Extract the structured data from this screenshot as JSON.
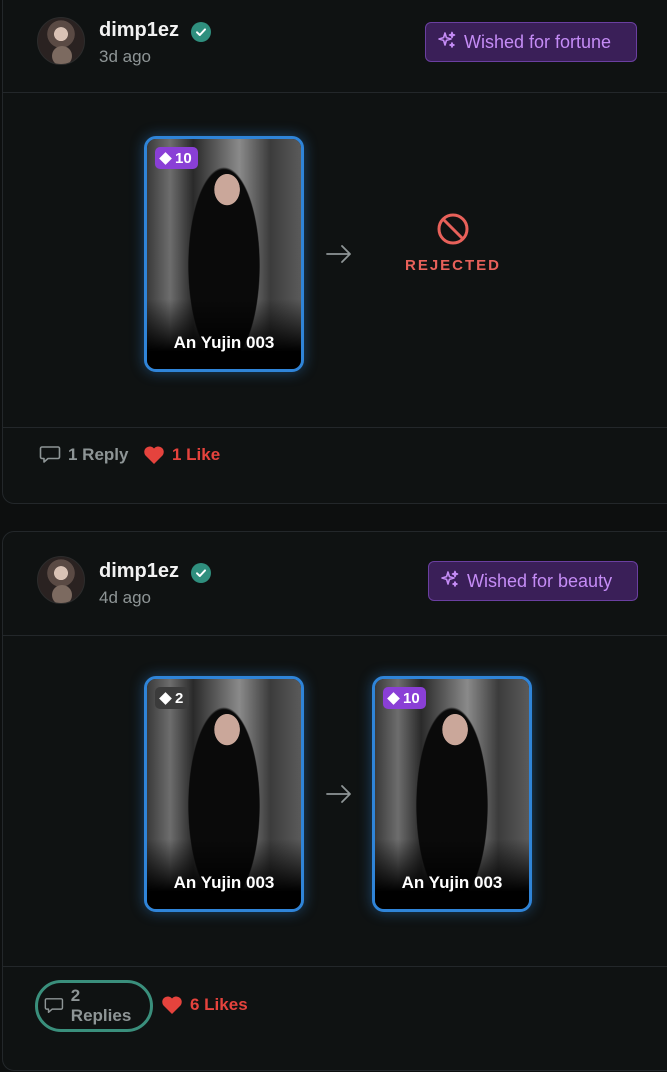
{
  "posts": [
    {
      "username": "dimp1ez",
      "time_ago": "3d ago",
      "wish_label": "Wished for fortune",
      "from_card": {
        "name": "An Yujin 003",
        "rank": "10"
      },
      "result_label": "REJECTED",
      "replies_label": "1 Reply",
      "likes_label": "1 Like"
    },
    {
      "username": "dimp1ez",
      "time_ago": "4d ago",
      "wish_label": "Wished for beauty",
      "from_card": {
        "name": "An Yujin 003",
        "rank": "2"
      },
      "to_card": {
        "name": "An Yujin 003",
        "rank": "10"
      },
      "replies_label": "2 Replies",
      "likes_label": "6 Likes"
    }
  ],
  "colors": {
    "accent_purple": "#c58cf6",
    "card_border": "#2f84d8",
    "like_red": "#e5433d",
    "verified_teal": "#2f8f7e",
    "rejected_red": "#e8615a"
  },
  "icons": [
    "sparkles-icon",
    "verified-check-icon",
    "diamond-icon",
    "arrow-right-icon",
    "block-icon",
    "comment-icon",
    "heart-icon"
  ]
}
